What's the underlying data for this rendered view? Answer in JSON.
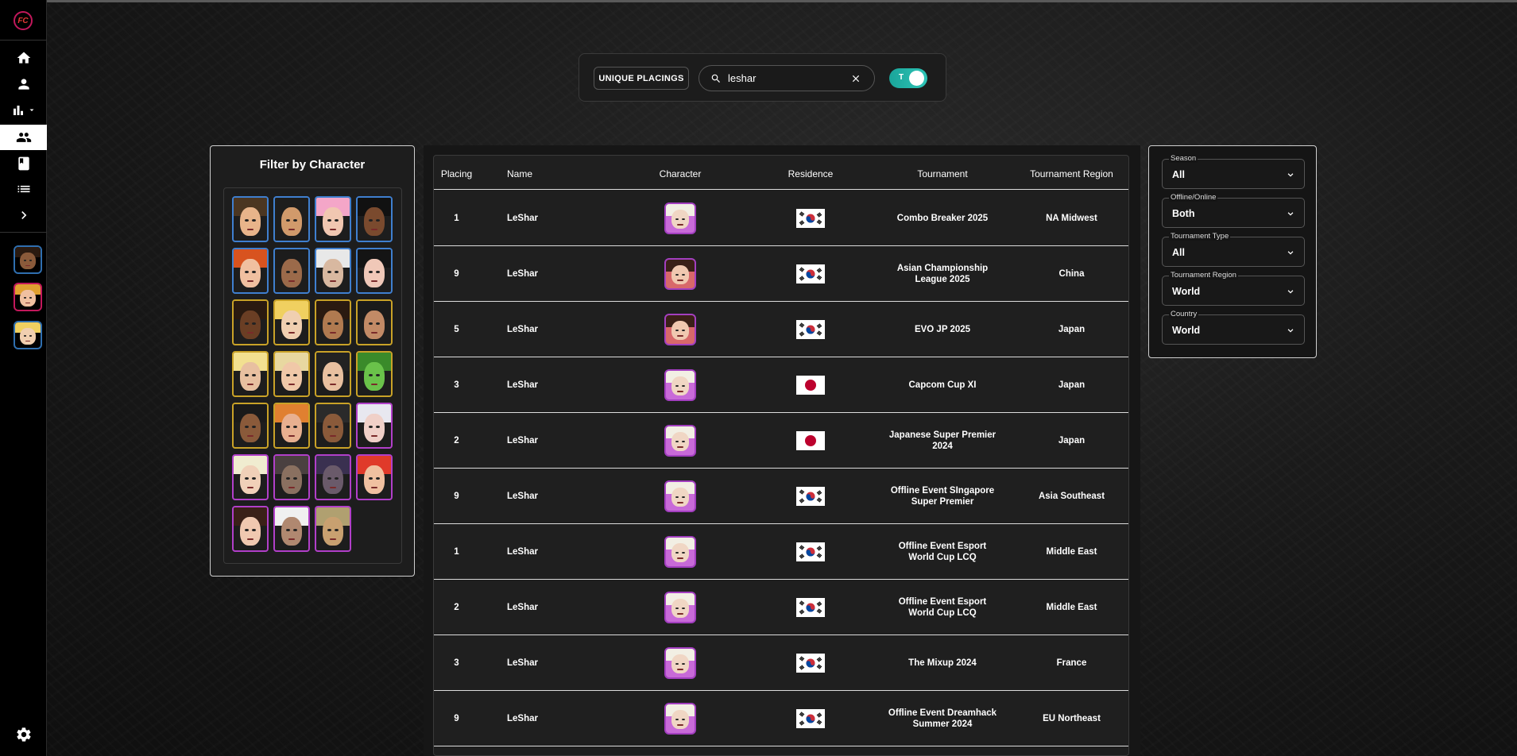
{
  "app": {
    "logo_text": "FC"
  },
  "sidebar": {
    "items": [
      {
        "name": "home",
        "icon": "home-icon"
      },
      {
        "name": "profile",
        "icon": "person-icon"
      },
      {
        "name": "stats",
        "icon": "bar-chart-icon"
      },
      {
        "name": "players",
        "icon": "group-icon",
        "active": true
      },
      {
        "name": "book",
        "icon": "book-icon"
      },
      {
        "name": "list",
        "icon": "list-icon"
      },
      {
        "name": "expand",
        "icon": "chevron-right-icon"
      }
    ]
  },
  "search": {
    "unique_label": "UNIQUE PLACINGS",
    "value": "leshar",
    "toggle_label": "T"
  },
  "filter": {
    "title": "Filter by Character",
    "characters": [
      {
        "hair": "#4b3621",
        "skin": "#e8b48a",
        "border": "blue"
      },
      {
        "hair": "#1d1d1d",
        "skin": "#d19a6b",
        "border": "blue"
      },
      {
        "hair": "#f4a6c8",
        "skin": "#f1c7b1",
        "border": "blue"
      },
      {
        "hair": "#111111",
        "skin": "#7a4a2e",
        "border": "blue"
      },
      {
        "hair": "#d8531f",
        "skin": "#f0c0a0",
        "border": "blue"
      },
      {
        "hair": "#1c1c1c",
        "skin": "#9b6a4a",
        "border": "blue"
      },
      {
        "hair": "#e8e8e8",
        "skin": "#d8b8a0",
        "border": "blue"
      },
      {
        "hair": "#141414",
        "skin": "#f0c8b8",
        "border": "blue"
      },
      {
        "hair": "#2a1a10",
        "skin": "#6a3e24",
        "border": "gold"
      },
      {
        "hair": "#f0d060",
        "skin": "#f0cfb0",
        "border": "gold"
      },
      {
        "hair": "#2a1a10",
        "skin": "#b07a50",
        "border": "gold"
      },
      {
        "hair": "#1a1a1a",
        "skin": "#c28a66",
        "border": "gold"
      },
      {
        "hair": "#f2e090",
        "skin": "#e8c0a0",
        "border": "gold"
      },
      {
        "hair": "#e8d8a0",
        "skin": "#f0c8a8",
        "border": "gold"
      },
      {
        "hair": "#222222",
        "skin": "#e8c0a0",
        "border": "gold"
      },
      {
        "hair": "#3a8a2a",
        "skin": "#6ac24a",
        "border": "gold"
      },
      {
        "hair": "#1a1a1a",
        "skin": "#8a5a3a",
        "border": "gold"
      },
      {
        "hair": "#e08030",
        "skin": "#e8b090",
        "border": "gold"
      },
      {
        "hair": "#2a2a2a",
        "skin": "#8a5a3a",
        "border": "gold"
      },
      {
        "hair": "#e8e8f0",
        "skin": "#f0d0c8",
        "border": "purple"
      },
      {
        "hair": "#f0ecd0",
        "skin": "#f0d0b8",
        "border": "purple"
      },
      {
        "hair": "#4a4040",
        "skin": "#8a7060",
        "border": "purple"
      },
      {
        "hair": "#3a3050",
        "skin": "#6a5a6a",
        "border": "purple"
      },
      {
        "hair": "#e03a2a",
        "skin": "#f0c0a0",
        "border": "purple"
      },
      {
        "hair": "#3a2018",
        "skin": "#f0c8b0",
        "border": "purple"
      },
      {
        "hair": "#f0f0f0",
        "skin": "#b08870",
        "border": "purple"
      },
      {
        "hair": "#b0a070",
        "skin": "#c8a070",
        "border": "purple"
      }
    ]
  },
  "table": {
    "headers": [
      "Placing",
      "Name",
      "Character",
      "Residence",
      "Tournament",
      "Tournament Region"
    ],
    "rows": [
      {
        "placing": "1",
        "name": "LeShar",
        "char": "blonde",
        "flag": "kr",
        "tournament": "Combo Breaker 2025",
        "region": "NA Midwest"
      },
      {
        "placing": "9",
        "name": "LeShar",
        "char": "brunette",
        "flag": "kr",
        "tournament": "Asian Championship League 2025",
        "region": "China"
      },
      {
        "placing": "5",
        "name": "LeShar",
        "char": "brunette",
        "flag": "kr",
        "tournament": "EVO JP 2025",
        "region": "Japan"
      },
      {
        "placing": "3",
        "name": "LeShar",
        "char": "blonde",
        "flag": "jp",
        "tournament": "Capcom Cup XI",
        "region": "Japan"
      },
      {
        "placing": "2",
        "name": "LeShar",
        "char": "blonde",
        "flag": "jp",
        "tournament": "Japanese Super Premier 2024",
        "region": "Japan"
      },
      {
        "placing": "9",
        "name": "LeShar",
        "char": "blonde",
        "flag": "kr",
        "tournament": "Offline Event SIngapore Super Premier",
        "region": "Asia Southeast"
      },
      {
        "placing": "1",
        "name": "LeShar",
        "char": "blonde",
        "flag": "kr",
        "tournament": "Offline Event Esport World Cup LCQ",
        "region": "Middle East"
      },
      {
        "placing": "2",
        "name": "LeShar",
        "char": "blonde",
        "flag": "kr",
        "tournament": "Offline Event Esport World Cup LCQ",
        "region": "Middle East"
      },
      {
        "placing": "3",
        "name": "LeShar",
        "char": "blonde",
        "flag": "kr",
        "tournament": "The Mixup 2024",
        "region": "France"
      },
      {
        "placing": "9",
        "name": "LeShar",
        "char": "blonde",
        "flag": "kr",
        "tournament": "Offline Event Dreamhack Summer 2024",
        "region": "EU Northeast"
      }
    ]
  },
  "filters": [
    {
      "label": "Season",
      "value": "All"
    },
    {
      "label": "Offline/Online",
      "value": "Both"
    },
    {
      "label": "Tournament Type",
      "value": "All"
    },
    {
      "label": "Tournament Region",
      "value": "World"
    },
    {
      "label": "Country",
      "value": "World"
    }
  ],
  "colors": {
    "accent": "#2ec4b6",
    "brand": "#c2185b",
    "char_border_blue": "#3f7fcf",
    "char_border_gold": "#c9a227",
    "char_border_purple": "#b13fc9"
  }
}
